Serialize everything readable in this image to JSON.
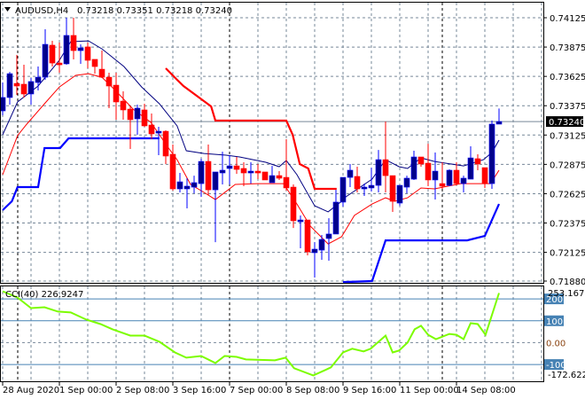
{
  "header": {
    "arrow_icon": "triangle-down-icon",
    "symbol": "AUDUSD,H4",
    "ohlc": "0.73218 0.73351 0.73218 0.73240"
  },
  "colors": {
    "bull_body": "#00008B",
    "bull_wick": "#0000FF",
    "bear": "#FF0000",
    "ma_fast": "#000080",
    "ma_slow": "#FF0000",
    "channel_upper": "#FF0000",
    "channel_lower": "#0000FF",
    "cci": "#7CFC00",
    "level": "#4682B4",
    "grid": "#778899"
  },
  "chart_data": [
    {
      "type": "candlestick",
      "title": "AUDUSD,H4",
      "ylim": [
        0.7188,
        0.74125
      ],
      "y_ticks": [
        "0.74125",
        "0.73875",
        "0.73625",
        "0.73375",
        "0.73125",
        "0.72875",
        "0.72625",
        "0.72375",
        "0.72125",
        "0.71880"
      ],
      "y_tick_values": [
        0.74125,
        0.73875,
        0.73625,
        0.73375,
        0.73125,
        0.72875,
        0.72625,
        0.72375,
        0.72125,
        0.7188
      ],
      "current_price_label": "0.73240",
      "current_price": 0.7324,
      "x_labels": [
        {
          "index": 0,
          "label": "28 Aug 2020"
        },
        {
          "index": 8,
          "label": "1 Sep 00:00"
        },
        {
          "index": 16,
          "label": "2 Sep 08:00"
        },
        {
          "index": 24,
          "label": "3 Sep 16:00"
        },
        {
          "index": 32,
          "label": "7 Sep 00:00"
        },
        {
          "index": 40,
          "label": "8 Sep 08:00"
        },
        {
          "index": 48,
          "label": "9 Sep 16:00"
        },
        {
          "index": 56,
          "label": "11 Sep 00:00"
        },
        {
          "index": 64,
          "label": "14 Sep 08:00"
        }
      ],
      "candles_ohlc": [
        [
          0.73331,
          0.73573,
          0.73293,
          0.73445
        ],
        [
          0.73445,
          0.73663,
          0.73384,
          0.73648
        ],
        [
          0.73565,
          0.73808,
          0.73467,
          0.73543
        ],
        [
          0.73558,
          0.73724,
          0.73445,
          0.73475
        ],
        [
          0.73475,
          0.73611,
          0.73384,
          0.73581
        ],
        [
          0.73573,
          0.73709,
          0.73505,
          0.73618
        ],
        [
          0.73618,
          0.74027,
          0.73596,
          0.73898
        ],
        [
          0.73891,
          0.73928,
          0.73709,
          0.73739
        ],
        [
          0.73739,
          0.73913,
          0.73656,
          0.73732
        ],
        [
          0.73732,
          0.74125,
          0.73724,
          0.73974
        ],
        [
          0.73974,
          0.74125,
          0.7377,
          0.73845
        ],
        [
          0.73845,
          0.73898,
          0.73732,
          0.73868
        ],
        [
          0.73876,
          0.73913,
          0.73694,
          0.73762
        ],
        [
          0.7377,
          0.7377,
          0.73648,
          0.73709
        ],
        [
          0.73686,
          0.73845,
          0.73611,
          0.73618
        ],
        [
          0.73618,
          0.73656,
          0.73354,
          0.73543
        ],
        [
          0.7355,
          0.73656,
          0.73256,
          0.73407
        ],
        [
          0.73414,
          0.73498,
          0.73256,
          0.73339
        ],
        [
          0.73346,
          0.73369,
          0.73006,
          0.73256
        ],
        [
          0.73263,
          0.73384,
          0.73127,
          0.73354
        ],
        [
          0.73339,
          0.73392,
          0.73195,
          0.73203
        ],
        [
          0.7321,
          0.73309,
          0.73089,
          0.73135
        ],
        [
          0.73142,
          0.73195,
          0.72953,
          0.73157
        ],
        [
          0.73157,
          0.73165,
          0.72878,
          0.72946
        ],
        [
          0.72961,
          0.73044,
          0.72651,
          0.72666
        ],
        [
          0.72666,
          0.72802,
          0.72636,
          0.72726
        ],
        [
          0.72666,
          0.72757,
          0.725,
          0.72689
        ],
        [
          0.72681,
          0.72779,
          0.72628,
          0.72719
        ],
        [
          0.72711,
          0.72923,
          0.72598,
          0.729
        ],
        [
          0.729,
          0.73044,
          0.72613,
          0.72658
        ],
        [
          0.72658,
          0.7281,
          0.72212,
          0.7281
        ],
        [
          0.72802,
          0.72983,
          0.72704,
          0.72825
        ],
        [
          0.7284,
          0.72953,
          0.72704,
          0.72862
        ],
        [
          0.72862,
          0.72938,
          0.72794,
          0.72832
        ],
        [
          0.7284,
          0.72893,
          0.72689,
          0.72802
        ],
        [
          0.7281,
          0.72893,
          0.72711,
          0.72817
        ],
        [
          0.72817,
          0.72878,
          0.72749,
          0.72802
        ],
        [
          0.7281,
          0.7281,
          0.72742,
          0.72742
        ],
        [
          0.72719,
          0.72862,
          0.72719,
          0.72779
        ],
        [
          0.72779,
          0.72817,
          0.72742,
          0.72757
        ],
        [
          0.72764,
          0.73089,
          0.72651,
          0.72674
        ],
        [
          0.72681,
          0.72704,
          0.72333,
          0.72394
        ],
        [
          0.72394,
          0.72439,
          0.7216,
          0.72401
        ],
        [
          0.72401,
          0.72401,
          0.72099,
          0.72129
        ],
        [
          0.72122,
          0.72212,
          0.7191,
          0.72152
        ],
        [
          0.72144,
          0.72273,
          0.72061,
          0.72235
        ],
        [
          0.72243,
          0.72416,
          0.72054,
          0.72281
        ],
        [
          0.72281,
          0.72658,
          0.72281,
          0.72553
        ],
        [
          0.72553,
          0.72764,
          0.72515,
          0.72764
        ],
        [
          0.72764,
          0.72878,
          0.72681,
          0.72825
        ],
        [
          0.72772,
          0.72855,
          0.72636,
          0.72666
        ],
        [
          0.72666,
          0.72711,
          0.72606,
          0.72681
        ],
        [
          0.72674,
          0.72847,
          0.72643,
          0.72696
        ],
        [
          0.72696,
          0.72998,
          0.72636,
          0.72915
        ],
        [
          0.72915,
          0.7324,
          0.72636,
          0.72779
        ],
        [
          0.72779,
          0.72779,
          0.7247,
          0.7256
        ],
        [
          0.72545,
          0.72696,
          0.72522,
          0.72696
        ],
        [
          0.72681,
          0.72779,
          0.72628,
          0.72757
        ],
        [
          0.72749,
          0.72991,
          0.72742,
          0.72938
        ],
        [
          0.72938,
          0.72938,
          0.72855,
          0.72878
        ],
        [
          0.72885,
          0.73051,
          0.72689,
          0.72742
        ],
        [
          0.72742,
          0.72976,
          0.72575,
          0.72817
        ],
        [
          0.72711,
          0.72893,
          0.72666,
          0.72689
        ],
        [
          0.72696,
          0.72832,
          0.72689,
          0.72825
        ],
        [
          0.72825,
          0.72893,
          0.72696,
          0.72711
        ],
        [
          0.72711,
          0.72779,
          0.72636,
          0.72757
        ],
        [
          0.72749,
          0.73029,
          0.72749,
          0.7293
        ],
        [
          0.72923,
          0.72961,
          0.72825,
          0.72878
        ],
        [
          0.72847,
          0.72847,
          0.72674,
          0.72711
        ],
        [
          0.72711,
          0.73248,
          0.72666,
          0.73218
        ],
        [
          0.73218,
          0.73351,
          0.73218,
          0.7324
        ]
      ],
      "lines": [
        {
          "name": "ma-fast",
          "color_key": "ma_fast",
          "points": [
            [
              0,
              0.73127
            ],
            [
              2.1,
              0.73407
            ],
            [
              5,
              0.73543
            ],
            [
              8,
              0.73762
            ],
            [
              9.6,
              0.73921
            ],
            [
              12.1,
              0.73928
            ],
            [
              14,
              0.7386
            ],
            [
              17.1,
              0.73709
            ],
            [
              19.6,
              0.73535
            ],
            [
              22.1,
              0.73392
            ],
            [
              24.6,
              0.73203
            ],
            [
              25.9,
              0.72991
            ],
            [
              28.4,
              0.72968
            ],
            [
              31.5,
              0.72953
            ],
            [
              33.4,
              0.72938
            ],
            [
              37.1,
              0.72893
            ],
            [
              39,
              0.72855
            ],
            [
              40,
              0.72908
            ],
            [
              41.5,
              0.72787
            ],
            [
              44,
              0.72522
            ],
            [
              45.9,
              0.7247
            ],
            [
              47.8,
              0.7256
            ],
            [
              48.4,
              0.72598
            ],
            [
              52.1,
              0.72749
            ],
            [
              54,
              0.72915
            ],
            [
              55.9,
              0.72855
            ],
            [
              57.1,
              0.7284
            ],
            [
              59,
              0.7293
            ],
            [
              60.9,
              0.729
            ],
            [
              65,
              0.72862
            ],
            [
              67.8,
              0.72915
            ],
            [
              69,
              0.72976
            ],
            [
              70,
              0.73082
            ]
          ]
        },
        {
          "name": "ma-slow",
          "color_key": "ma_slow",
          "points": [
            [
              0,
              0.72787
            ],
            [
              2.1,
              0.7312
            ],
            [
              3.4,
              0.73218
            ],
            [
              5.9,
              0.73392
            ],
            [
              8,
              0.73535
            ],
            [
              10.3,
              0.73634
            ],
            [
              12.1,
              0.73648
            ],
            [
              14,
              0.73618
            ],
            [
              15.9,
              0.73505
            ],
            [
              18.4,
              0.73346
            ],
            [
              20.9,
              0.73233
            ],
            [
              23.4,
              0.73014
            ],
            [
              24.6,
              0.72915
            ],
            [
              26.5,
              0.72704
            ],
            [
              28.4,
              0.72636
            ],
            [
              30,
              0.72575
            ],
            [
              32.8,
              0.72704
            ],
            [
              35.9,
              0.72711
            ],
            [
              39.6,
              0.72711
            ],
            [
              41.5,
              0.72537
            ],
            [
              43.4,
              0.72348
            ],
            [
              45.9,
              0.72197
            ],
            [
              47.8,
              0.72258
            ],
            [
              49.6,
              0.72439
            ],
            [
              52.1,
              0.72537
            ],
            [
              54,
              0.7259
            ],
            [
              55.3,
              0.7256
            ],
            [
              57.1,
              0.7259
            ],
            [
              59,
              0.72674
            ],
            [
              60.9,
              0.72666
            ],
            [
              64.6,
              0.72711
            ],
            [
              68.8,
              0.72711
            ],
            [
              70,
              0.72825
            ]
          ]
        },
        {
          "name": "channel-upper",
          "color_key": "channel_upper",
          "thick": true,
          "points": [
            [
              23,
              0.73694
            ],
            [
              24.6,
              0.73596
            ],
            [
              25.5,
              0.73543
            ],
            [
              29.4,
              0.73369
            ],
            [
              30,
              0.73248
            ],
            [
              40,
              0.73248
            ],
            [
              40.9,
              0.73127
            ],
            [
              41.9,
              0.72878
            ],
            [
              43.1,
              0.7284
            ],
            [
              44,
              0.72666
            ],
            [
              47.1,
              0.72666
            ]
          ]
        },
        {
          "name": "channel-lower-1",
          "color_key": "channel_lower",
          "thick": true,
          "points": [
            [
              0,
              0.72485
            ],
            [
              1.3,
              0.7256
            ],
            [
              2.1,
              0.72681
            ],
            [
              5,
              0.72681
            ],
            [
              5.9,
              0.73014
            ],
            [
              8.1,
              0.73014
            ],
            [
              9.3,
              0.73097
            ],
            [
              22.1,
              0.73097
            ]
          ]
        },
        {
          "name": "channel-lower-2",
          "color_key": "channel_lower",
          "thick": true,
          "points": [
            [
              48,
              0.71872
            ],
            [
              52.1,
              0.7188
            ],
            [
              54,
              0.72227
            ],
            [
              65.5,
              0.72227
            ],
            [
              68,
              0.72265
            ],
            [
              70,
              0.72537
            ]
          ]
        }
      ]
    },
    {
      "type": "line",
      "title": "CCI(40) 226.9247",
      "ylim": [
        -172.6224,
        253.1679
      ],
      "max_label": "253.1679",
      "min_label": "-172.6224",
      "levels": [
        {
          "value": 200,
          "label": "200",
          "boxed": true
        },
        {
          "value": 100,
          "label": "100",
          "boxed": true
        },
        {
          "value": 0,
          "label": "0.00",
          "boxed": false
        },
        {
          "value": -100,
          "label": "-100",
          "boxed": true
        }
      ],
      "points": [
        [
          0,
          235
        ],
        [
          2.1,
          206
        ],
        [
          4,
          158
        ],
        [
          5.9,
          162
        ],
        [
          7.8,
          142
        ],
        [
          9.6,
          138
        ],
        [
          11.8,
          105
        ],
        [
          13.8,
          85
        ],
        [
          15.5,
          61
        ],
        [
          18,
          32
        ],
        [
          20,
          32
        ],
        [
          22.1,
          4
        ],
        [
          24.3,
          -45
        ],
        [
          25.9,
          -69
        ],
        [
          28,
          -61
        ],
        [
          30,
          -93
        ],
        [
          31.3,
          -61
        ],
        [
          33,
          -65
        ],
        [
          34.3,
          -77
        ],
        [
          38.4,
          -81
        ],
        [
          39.9,
          -69
        ],
        [
          41.1,
          -117
        ],
        [
          43.8,
          -150
        ],
        [
          45.5,
          -125
        ],
        [
          46.3,
          -113
        ],
        [
          48,
          -45
        ],
        [
          49.3,
          -28
        ],
        [
          50.9,
          -40
        ],
        [
          51.9,
          -28
        ],
        [
          54,
          32
        ],
        [
          55,
          -45
        ],
        [
          55.9,
          -36
        ],
        [
          57.1,
          0
        ],
        [
          58.1,
          61
        ],
        [
          59,
          77
        ],
        [
          60,
          36
        ],
        [
          61.1,
          16
        ],
        [
          63,
          40
        ],
        [
          64,
          36
        ],
        [
          65,
          16
        ],
        [
          66,
          89
        ],
        [
          67,
          85
        ],
        [
          68.1,
          36
        ],
        [
          70,
          226.92
        ]
      ]
    }
  ]
}
